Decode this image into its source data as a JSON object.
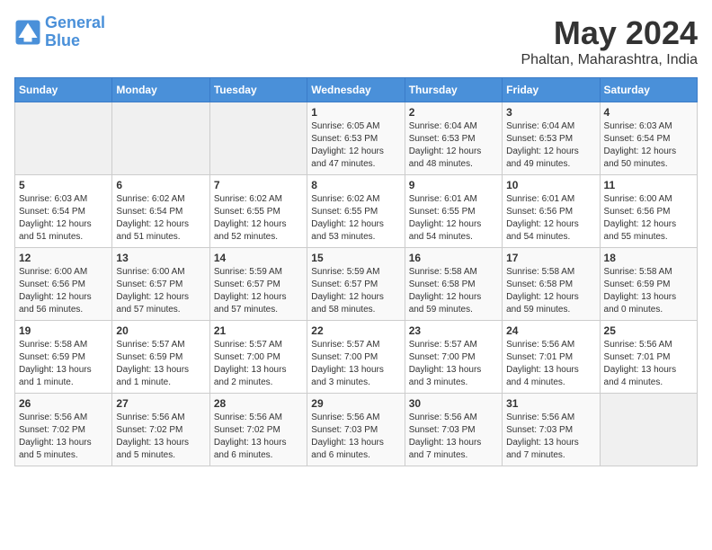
{
  "logo": {
    "line1": "General",
    "line2": "Blue"
  },
  "title": "May 2024",
  "subtitle": "Phaltan, Maharashtra, India",
  "headers": [
    "Sunday",
    "Monday",
    "Tuesday",
    "Wednesday",
    "Thursday",
    "Friday",
    "Saturday"
  ],
  "weeks": [
    [
      {
        "num": "",
        "info": ""
      },
      {
        "num": "",
        "info": ""
      },
      {
        "num": "",
        "info": ""
      },
      {
        "num": "1",
        "info": "Sunrise: 6:05 AM\nSunset: 6:53 PM\nDaylight: 12 hours\nand 47 minutes."
      },
      {
        "num": "2",
        "info": "Sunrise: 6:04 AM\nSunset: 6:53 PM\nDaylight: 12 hours\nand 48 minutes."
      },
      {
        "num": "3",
        "info": "Sunrise: 6:04 AM\nSunset: 6:53 PM\nDaylight: 12 hours\nand 49 minutes."
      },
      {
        "num": "4",
        "info": "Sunrise: 6:03 AM\nSunset: 6:54 PM\nDaylight: 12 hours\nand 50 minutes."
      }
    ],
    [
      {
        "num": "5",
        "info": "Sunrise: 6:03 AM\nSunset: 6:54 PM\nDaylight: 12 hours\nand 51 minutes."
      },
      {
        "num": "6",
        "info": "Sunrise: 6:02 AM\nSunset: 6:54 PM\nDaylight: 12 hours\nand 51 minutes."
      },
      {
        "num": "7",
        "info": "Sunrise: 6:02 AM\nSunset: 6:55 PM\nDaylight: 12 hours\nand 52 minutes."
      },
      {
        "num": "8",
        "info": "Sunrise: 6:02 AM\nSunset: 6:55 PM\nDaylight: 12 hours\nand 53 minutes."
      },
      {
        "num": "9",
        "info": "Sunrise: 6:01 AM\nSunset: 6:55 PM\nDaylight: 12 hours\nand 54 minutes."
      },
      {
        "num": "10",
        "info": "Sunrise: 6:01 AM\nSunset: 6:56 PM\nDaylight: 12 hours\nand 54 minutes."
      },
      {
        "num": "11",
        "info": "Sunrise: 6:00 AM\nSunset: 6:56 PM\nDaylight: 12 hours\nand 55 minutes."
      }
    ],
    [
      {
        "num": "12",
        "info": "Sunrise: 6:00 AM\nSunset: 6:56 PM\nDaylight: 12 hours\nand 56 minutes."
      },
      {
        "num": "13",
        "info": "Sunrise: 6:00 AM\nSunset: 6:57 PM\nDaylight: 12 hours\nand 57 minutes."
      },
      {
        "num": "14",
        "info": "Sunrise: 5:59 AM\nSunset: 6:57 PM\nDaylight: 12 hours\nand 57 minutes."
      },
      {
        "num": "15",
        "info": "Sunrise: 5:59 AM\nSunset: 6:57 PM\nDaylight: 12 hours\nand 58 minutes."
      },
      {
        "num": "16",
        "info": "Sunrise: 5:58 AM\nSunset: 6:58 PM\nDaylight: 12 hours\nand 59 minutes."
      },
      {
        "num": "17",
        "info": "Sunrise: 5:58 AM\nSunset: 6:58 PM\nDaylight: 12 hours\nand 59 minutes."
      },
      {
        "num": "18",
        "info": "Sunrise: 5:58 AM\nSunset: 6:59 PM\nDaylight: 13 hours\nand 0 minutes."
      }
    ],
    [
      {
        "num": "19",
        "info": "Sunrise: 5:58 AM\nSunset: 6:59 PM\nDaylight: 13 hours\nand 1 minute."
      },
      {
        "num": "20",
        "info": "Sunrise: 5:57 AM\nSunset: 6:59 PM\nDaylight: 13 hours\nand 1 minute."
      },
      {
        "num": "21",
        "info": "Sunrise: 5:57 AM\nSunset: 7:00 PM\nDaylight: 13 hours\nand 2 minutes."
      },
      {
        "num": "22",
        "info": "Sunrise: 5:57 AM\nSunset: 7:00 PM\nDaylight: 13 hours\nand 3 minutes."
      },
      {
        "num": "23",
        "info": "Sunrise: 5:57 AM\nSunset: 7:00 PM\nDaylight: 13 hours\nand 3 minutes."
      },
      {
        "num": "24",
        "info": "Sunrise: 5:56 AM\nSunset: 7:01 PM\nDaylight: 13 hours\nand 4 minutes."
      },
      {
        "num": "25",
        "info": "Sunrise: 5:56 AM\nSunset: 7:01 PM\nDaylight: 13 hours\nand 4 minutes."
      }
    ],
    [
      {
        "num": "26",
        "info": "Sunrise: 5:56 AM\nSunset: 7:02 PM\nDaylight: 13 hours\nand 5 minutes."
      },
      {
        "num": "27",
        "info": "Sunrise: 5:56 AM\nSunset: 7:02 PM\nDaylight: 13 hours\nand 5 minutes."
      },
      {
        "num": "28",
        "info": "Sunrise: 5:56 AM\nSunset: 7:02 PM\nDaylight: 13 hours\nand 6 minutes."
      },
      {
        "num": "29",
        "info": "Sunrise: 5:56 AM\nSunset: 7:03 PM\nDaylight: 13 hours\nand 6 minutes."
      },
      {
        "num": "30",
        "info": "Sunrise: 5:56 AM\nSunset: 7:03 PM\nDaylight: 13 hours\nand 7 minutes."
      },
      {
        "num": "31",
        "info": "Sunrise: 5:56 AM\nSunset: 7:03 PM\nDaylight: 13 hours\nand 7 minutes."
      },
      {
        "num": "",
        "info": ""
      }
    ]
  ]
}
